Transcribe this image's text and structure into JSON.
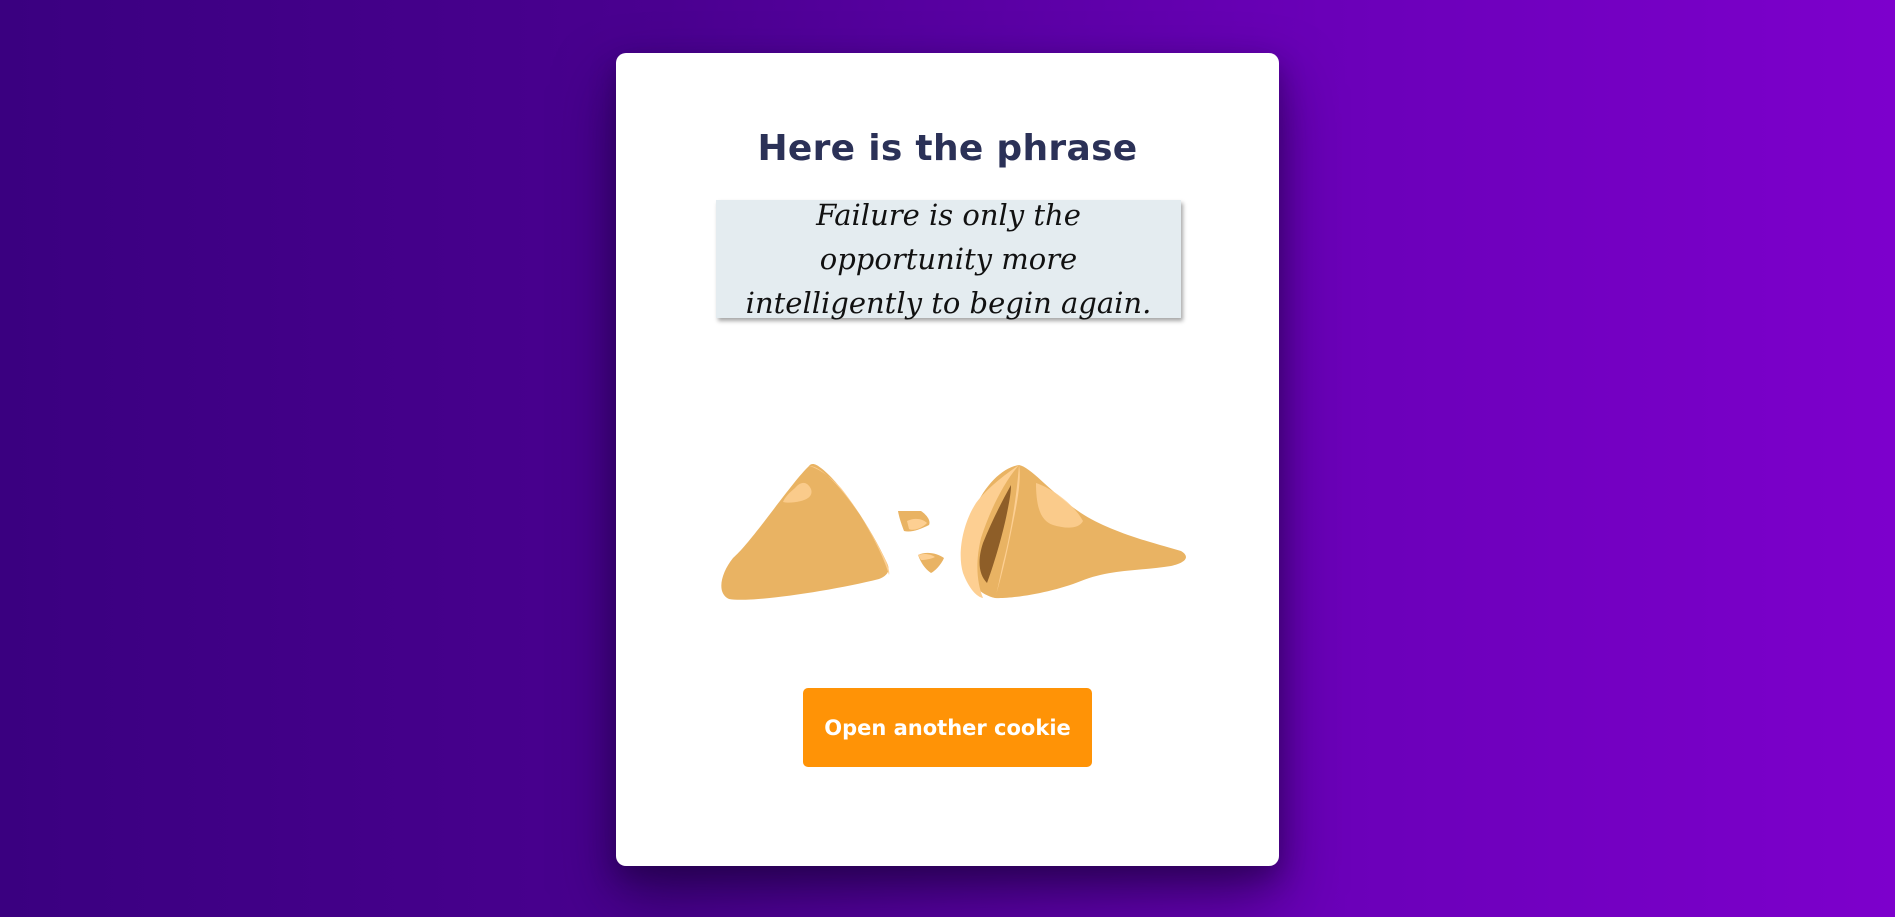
{
  "card": {
    "title": "Here is the phrase",
    "phrase": "Failure is only the opportunity more intelligently to begin again.",
    "button_label": "Open another cookie"
  },
  "icons": {
    "cookie": "fortune-cookie-broken-icon"
  },
  "colors": {
    "background_start": "#3a0080",
    "background_end": "#7d00cc",
    "title": "#2b3157",
    "phrase_box": "#e4ecf0",
    "button": "#ff9306",
    "cookie": "#e9b363",
    "cookie_light": "#fdcf92",
    "cookie_dark": "#8e5e28"
  }
}
